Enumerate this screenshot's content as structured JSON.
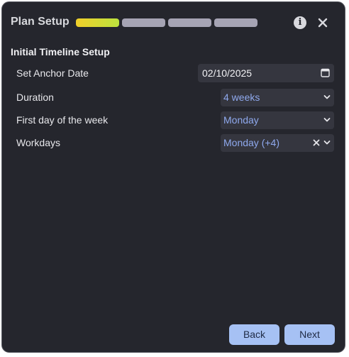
{
  "header": {
    "title": "Plan Setup",
    "progress": {
      "total_steps": 4,
      "current_step": 1
    },
    "info_icon": "info-icon",
    "close_icon": "close-icon"
  },
  "section": {
    "title": "Initial Timeline Setup"
  },
  "fields": {
    "anchor_date": {
      "label": "Set Anchor Date",
      "value": "02/10/2025",
      "icon": "calendar-icon"
    },
    "duration": {
      "label": "Duration",
      "value": "4 weeks"
    },
    "first_day": {
      "label": "First day of the week",
      "value": "Monday"
    },
    "workdays": {
      "label": "Workdays",
      "value": "Monday (+4)"
    }
  },
  "footer": {
    "back_label": "Back",
    "next_label": "Next"
  },
  "colors": {
    "background": "#25262d",
    "accent": "#a6c1f4",
    "select_text": "#8fa9ee",
    "progress_active_start": "#f1cf2a",
    "progress_active_end": "#bce33e",
    "progress_inactive": "#a6a4b4"
  }
}
